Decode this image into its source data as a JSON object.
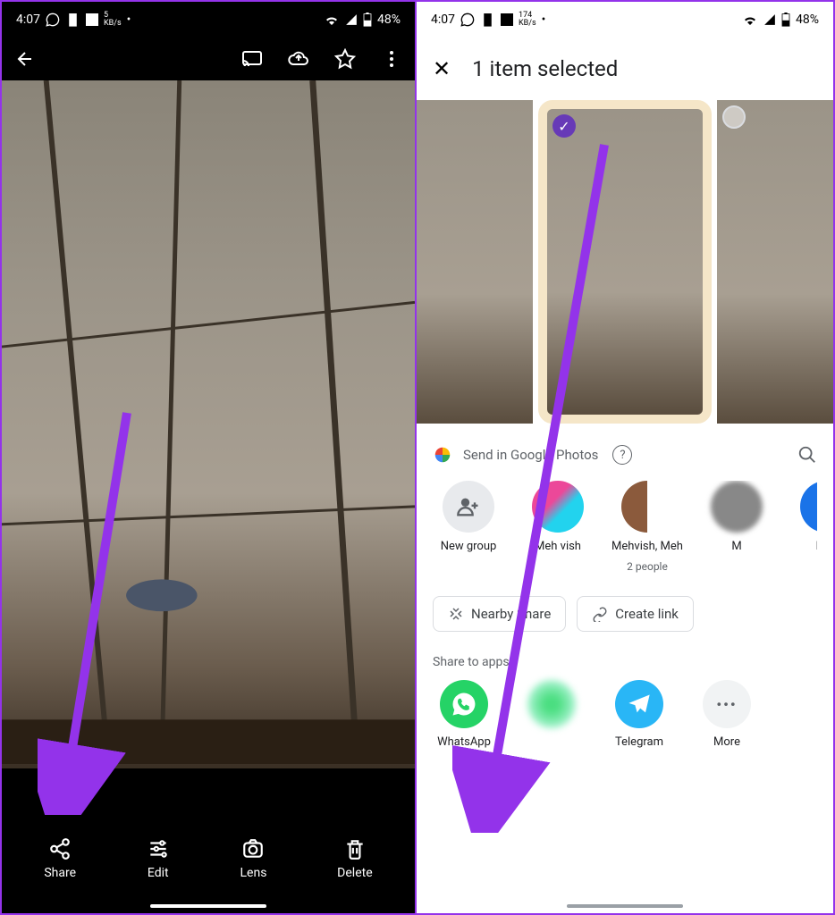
{
  "left": {
    "status": {
      "time": "4:07",
      "kbps_value": "5",
      "kbps_unit": "KB/s",
      "battery": "48%"
    },
    "bottom": {
      "share": "Share",
      "edit": "Edit",
      "lens": "Lens",
      "delete": "Delete"
    }
  },
  "right": {
    "status": {
      "time": "4:07",
      "kbps_value": "174",
      "kbps_unit": "KB/s",
      "battery": "48%"
    },
    "header": {
      "title": "1 item selected"
    },
    "share_header": {
      "label": "Send in Google Photos"
    },
    "contacts": [
      {
        "name": "New group",
        "sub": ""
      },
      {
        "name": "Meh vish",
        "sub": ""
      },
      {
        "name": "Mehvish, Meh",
        "sub": "2 people"
      },
      {
        "name": "M",
        "sub": ""
      },
      {
        "name": "MM",
        "sub": ""
      }
    ],
    "chips": {
      "nearby": "Nearby Share",
      "link": "Create link"
    },
    "share_apps_label": "Share to apps",
    "apps": {
      "whatsapp": "WhatsApp",
      "telegram": "Telegram",
      "more": "More"
    }
  }
}
